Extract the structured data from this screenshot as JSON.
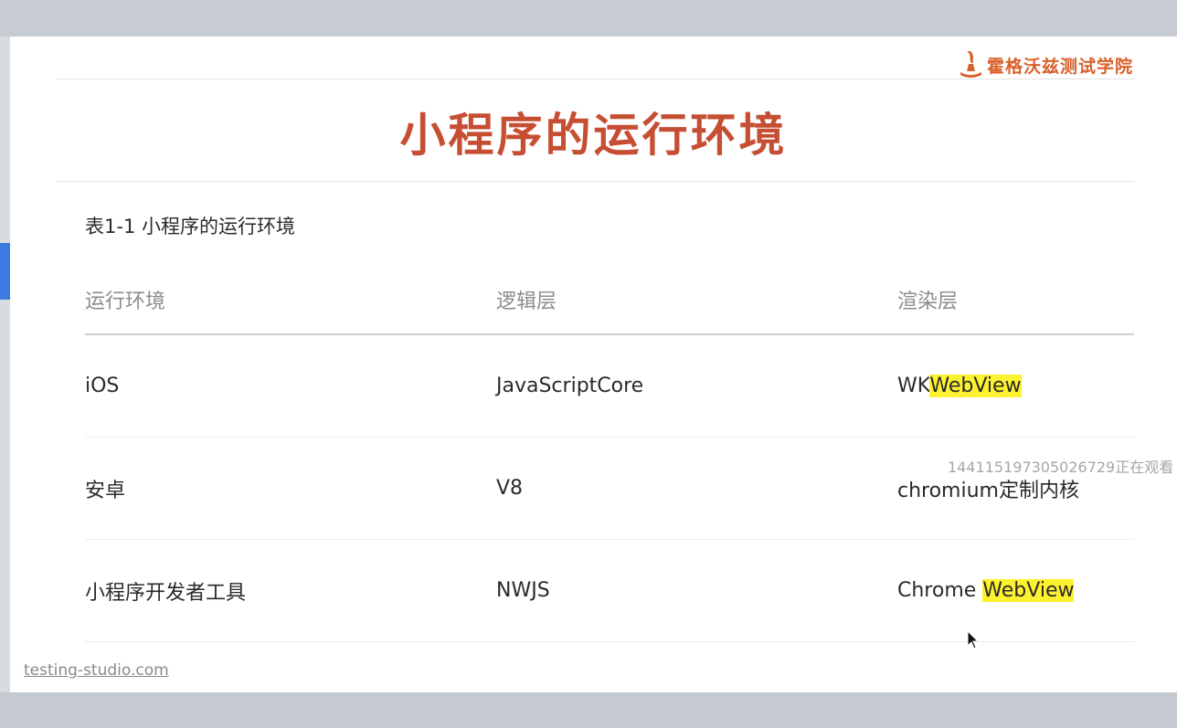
{
  "brand": {
    "name": "霍格沃兹测试学院",
    "color": "#d9612b"
  },
  "slide": {
    "title": "小程序的运行环境",
    "caption": "表1-1 小程序的运行环境",
    "footer": "testing-studio.com"
  },
  "table": {
    "headers": [
      "运行环境",
      "逻辑层",
      "渲染层"
    ],
    "rows": [
      {
        "env": "iOS",
        "logic": "JavaScriptCore",
        "render_prefix": "WK",
        "render_highlight": "WebView"
      },
      {
        "env": "安卓",
        "logic": "V8",
        "render_prefix": "chromium定制内核",
        "render_highlight": ""
      },
      {
        "env": "小程序开发者工具",
        "logic": "NWJS",
        "render_prefix": "Chrome ",
        "render_highlight": "WebView"
      }
    ]
  },
  "overlay": {
    "text": "144115197305026729正在观看"
  },
  "colors": {
    "title": "#c64f33",
    "highlight": "#fdf22f"
  },
  "icons": {
    "logo": "lamp-logo-icon",
    "cursor": "mouse-pointer-icon"
  }
}
